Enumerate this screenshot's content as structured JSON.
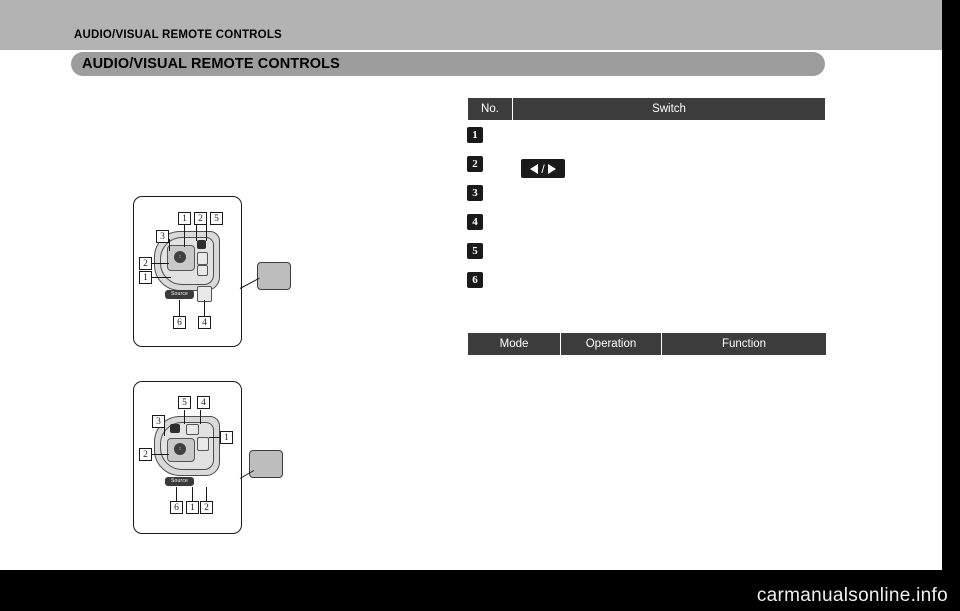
{
  "page": {
    "header_title": "AUDIO/VISUAL REMOTE CONTROLS",
    "section_title": "AUDIO/VISUAL REMOTE CONTROLS",
    "background_color": "#000000",
    "sheet_color": "#ffffff",
    "header_band_color": "#b3b3b3",
    "title_bar_color": "#9d9d9d",
    "table_header_color": "#3c3c3c"
  },
  "switch_table": {
    "headers": [
      "No.",
      "Switch"
    ],
    "rows": [
      {
        "no": "1",
        "switch": ""
      },
      {
        "no": "2",
        "switch": "seek-left-right-icon"
      },
      {
        "no": "3",
        "switch": ""
      },
      {
        "no": "4",
        "switch": ""
      },
      {
        "no": "5",
        "switch": ""
      },
      {
        "no": "6",
        "switch": ""
      }
    ]
  },
  "mode_table": {
    "headers": [
      "Mode",
      "Operation",
      "Function"
    ],
    "rows": []
  },
  "illustration_a": {
    "caption": "",
    "callouts": [
      "1",
      "2",
      "5",
      "3",
      "2",
      "1",
      "6",
      "4"
    ],
    "source_label": "Source"
  },
  "illustration_b": {
    "caption": "",
    "callouts": [
      "5",
      "4",
      "3",
      "1",
      "2",
      "6",
      "1",
      "2"
    ],
    "source_label": "Source"
  },
  "watermark": {
    "text": "carmanualsonline.info"
  }
}
